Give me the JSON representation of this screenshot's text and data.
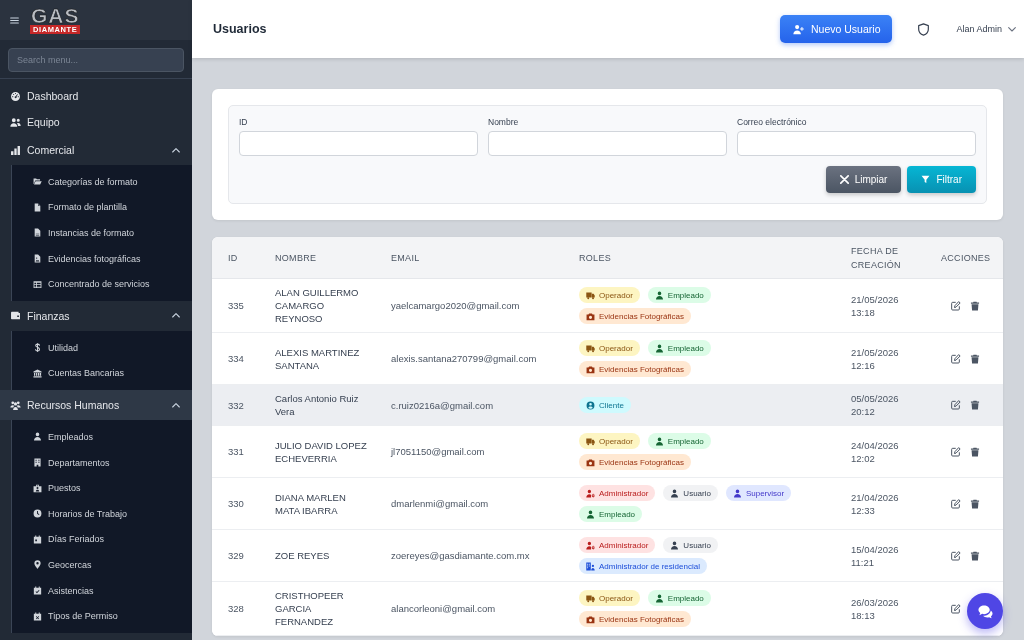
{
  "sidebar": {
    "logo": {
      "wordmark": "GAS",
      "band": "DIAMANTE"
    },
    "search": {
      "placeholder": "Search menu..."
    },
    "items": [
      {
        "label": "Dashboard",
        "selected": false
      },
      {
        "label": "Equipo",
        "selected": false
      },
      {
        "label": "Comercial",
        "selected": false,
        "expanded": true,
        "children": [
          {
            "label": "Categorías de formato",
            "selected": false
          },
          {
            "label": "Formato de plantilla",
            "selected": false
          },
          {
            "label": "Instancias de formato",
            "selected": false
          },
          {
            "label": "Evidencias fotográficas",
            "selected": false
          },
          {
            "label": "Concentrado de servicios",
            "selected": false
          }
        ]
      },
      {
        "label": "Finanzas",
        "selected": false,
        "expanded": true,
        "children": [
          {
            "label": "Utilidad",
            "selected": false
          },
          {
            "label": "Cuentas Bancarias",
            "selected": false
          }
        ]
      },
      {
        "label": "Recursos Humanos",
        "selected": true,
        "expanded": true,
        "children": [
          {
            "label": "Empleados",
            "selected": false
          },
          {
            "label": "Departamentos",
            "selected": false
          },
          {
            "label": "Puestos",
            "selected": false
          },
          {
            "label": "Horarios de Trabajo",
            "selected": false
          },
          {
            "label": "Días Feriados",
            "selected": false
          },
          {
            "label": "Geocercas",
            "selected": false
          },
          {
            "label": "Asistencias",
            "selected": false
          },
          {
            "label": "Tipos de Permiso",
            "selected": false
          }
        ]
      }
    ]
  },
  "header": {
    "title": "Usuarios",
    "new_user_button": "Nuevo Usuario",
    "user_name": "Alan Admin"
  },
  "filters": {
    "fields": [
      {
        "label": "ID"
      },
      {
        "label": "Nombre"
      },
      {
        "label": "Correo electrónico"
      }
    ],
    "buttons": [
      {
        "label": "Limpiar",
        "kind": "clear"
      },
      {
        "label": "Filtrar",
        "kind": "filter"
      }
    ]
  },
  "table": {
    "columns": [
      "ID",
      "NOMBRE",
      "EMAIL",
      "ROLES",
      "FECHA DE CREACIÓN",
      "ACCIONES"
    ],
    "rows": [
      {
        "id": "335",
        "name": "ALAN GUILLERMO CAMARGO REYNOSO",
        "email": "yaelcamargo2020@gmail.com",
        "roles": [
          {
            "label": "Operador",
            "kind": "operator"
          },
          {
            "label": "Empleado",
            "kind": "employee"
          },
          {
            "label": "Evidencias Fotográficas",
            "kind": "evidence"
          }
        ],
        "created": "21/05/2026 13:18",
        "hovered": false,
        "actions": [
          {
            "kind": "edit"
          },
          {
            "kind": "delete"
          }
        ]
      },
      {
        "id": "334",
        "name": "ALEXIS MARTINEZ SANTANA",
        "email": "alexis.santana270799@gmail.com",
        "roles": [
          {
            "label": "Operador",
            "kind": "operator"
          },
          {
            "label": "Empleado",
            "kind": "employee"
          },
          {
            "label": "Evidencias Fotográficas",
            "kind": "evidence"
          }
        ],
        "created": "21/05/2026 12:16",
        "hovered": false,
        "actions": [
          {
            "kind": "edit"
          },
          {
            "kind": "delete"
          }
        ]
      },
      {
        "id": "332",
        "name": "Carlos Antonio Ruiz Vera",
        "email": "c.ruiz0216a@gmail.com",
        "roles": [
          {
            "label": "Cliente",
            "kind": "client"
          }
        ],
        "created": "05/05/2026 20:12",
        "hovered": true,
        "actions": [
          {
            "kind": "edit"
          },
          {
            "kind": "delete"
          }
        ]
      },
      {
        "id": "331",
        "name": "JULIO DAVID LOPEZ ECHEVERRIA",
        "email": "jl7051150@gmail.com",
        "roles": [
          {
            "label": "Operador",
            "kind": "operator"
          },
          {
            "label": "Empleado",
            "kind": "employee"
          },
          {
            "label": "Evidencias Fotográficas",
            "kind": "evidence"
          }
        ],
        "created": "24/04/2026 12:02",
        "hovered": false,
        "actions": [
          {
            "kind": "edit"
          },
          {
            "kind": "delete"
          }
        ]
      },
      {
        "id": "330",
        "name": "DIANA MARLEN MATA IBARRA",
        "email": "dmarlenmi@gmail.com",
        "roles": [
          {
            "label": "Administrador",
            "kind": "admin"
          },
          {
            "label": "Usuario",
            "kind": "user"
          },
          {
            "label": "Supervisor",
            "kind": "supervisor"
          },
          {
            "label": "Empleado",
            "kind": "employee"
          }
        ],
        "created": "21/04/2026 12:33",
        "hovered": false,
        "actions": [
          {
            "kind": "edit"
          },
          {
            "kind": "delete"
          }
        ]
      },
      {
        "id": "329",
        "name": "ZOE REYES",
        "email": "zoereyes@gasdiamante.com.mx",
        "roles": [
          {
            "label": "Administrador",
            "kind": "admin"
          },
          {
            "label": "Usuario",
            "kind": "user"
          },
          {
            "label": "Administrador de residencial",
            "kind": "residential"
          }
        ],
        "created": "15/04/2026 11:21",
        "hovered": false,
        "actions": [
          {
            "kind": "edit"
          },
          {
            "kind": "delete"
          }
        ]
      },
      {
        "id": "328",
        "name": "CRISTHOPEER GARCIA FERNANDEZ",
        "email": "alancorleoni@gmail.com",
        "roles": [
          {
            "label": "Operador",
            "kind": "operator"
          },
          {
            "label": "Empleado",
            "kind": "employee"
          },
          {
            "label": "Evidencias Fotográficas",
            "kind": "evidence"
          }
        ],
        "created": "26/03/2026 18:13",
        "hovered": false,
        "actions": [
          {
            "kind": "edit"
          }
        ]
      }
    ]
  }
}
